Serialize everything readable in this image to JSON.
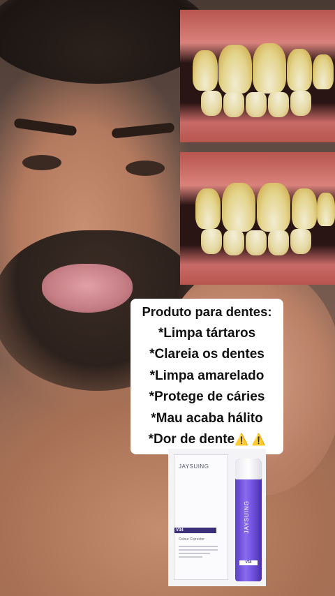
{
  "caption": {
    "lines": [
      "Produto para dentes:",
      "*Limpa tártaros",
      "*Clareia os dentes",
      "*Limpa amarelado",
      "*Protege de cáries",
      "*Mau acaba hálito",
      "*Dor de dente"
    ],
    "warning_emoji": "⚠️ ⚠️"
  },
  "product": {
    "box_brand": "JAYSUING",
    "box_variant": "V34",
    "box_subtitle": "Colour Corrector",
    "tube_brand": "JAYSUING",
    "tube_badge": "V34"
  },
  "colors": {
    "tube_purple": "#6a4ed9",
    "caption_bg": "#ffffff",
    "caption_text": "#111111"
  }
}
